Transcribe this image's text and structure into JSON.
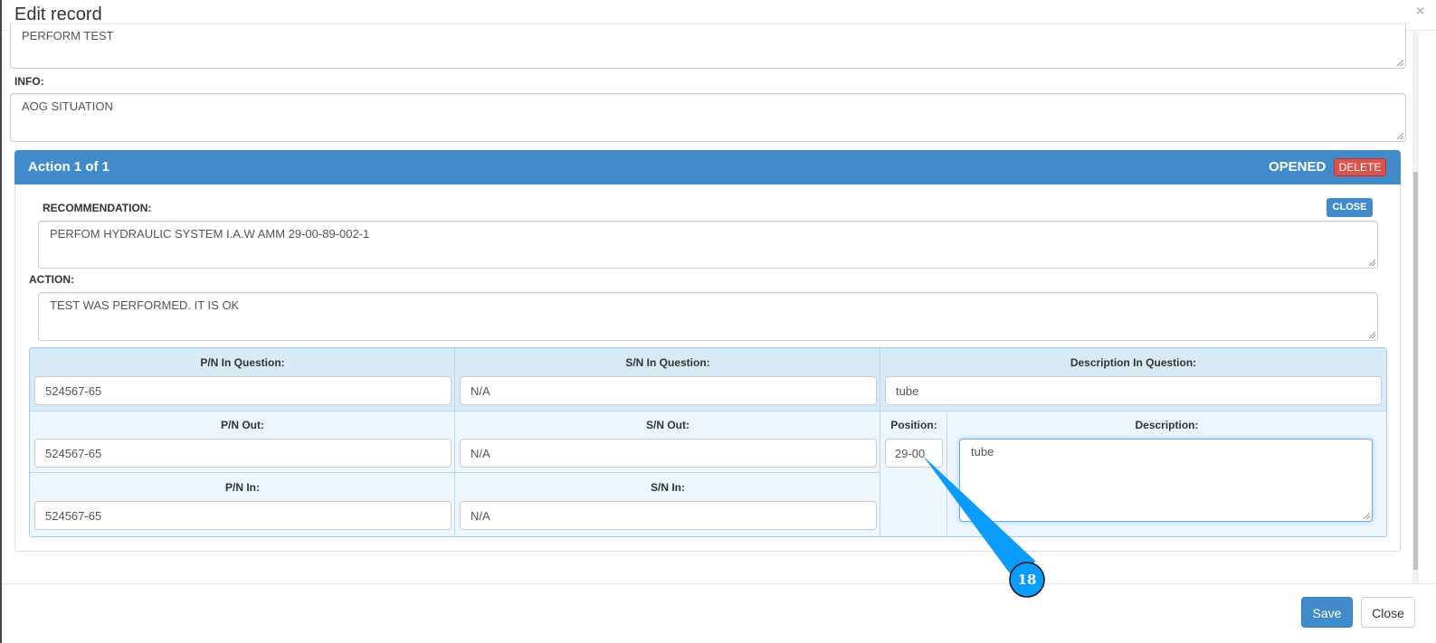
{
  "modal": {
    "title": "Edit record",
    "close_icon": "×"
  },
  "fields": {
    "description_value": "PERFORM TEST",
    "info_label": "INFO:",
    "info_value": "AOG SITUATION"
  },
  "action": {
    "header": "Action 1 of 1",
    "status": "OPENED",
    "delete_label": "DELETE",
    "close_label": "CLOSE",
    "recommendation_label": "RECOMMENDATION:",
    "recommendation_value": "PERFOM HYDRAULIC SYSTEM I.A.W AMM 29-00-89-002-1",
    "action_label": "ACTION:",
    "action_value": "TEST WAS PERFORMED. IT IS OK"
  },
  "parts": {
    "pn_question_label": "P/N In Question:",
    "pn_question": "524567-65",
    "sn_question_label": "S/N In Question:",
    "sn_question": "N/A",
    "desc_question_label": "Description In Question:",
    "desc_question": "tube",
    "pn_out_label": "P/N Out:",
    "pn_out": "524567-65",
    "sn_out_label": "S/N Out:",
    "sn_out": "N/A",
    "position_label": "Position:",
    "position": "29-00",
    "description_label": "Description:",
    "description": "tube",
    "pn_in_label": "P/N In:",
    "pn_in": "524567-65",
    "sn_in_label": "S/N In:",
    "sn_in": "N/A"
  },
  "footer": {
    "save_label": "Save",
    "close_label": "Close"
  },
  "callout": {
    "number": "18",
    "color": "#0b9bfa"
  }
}
